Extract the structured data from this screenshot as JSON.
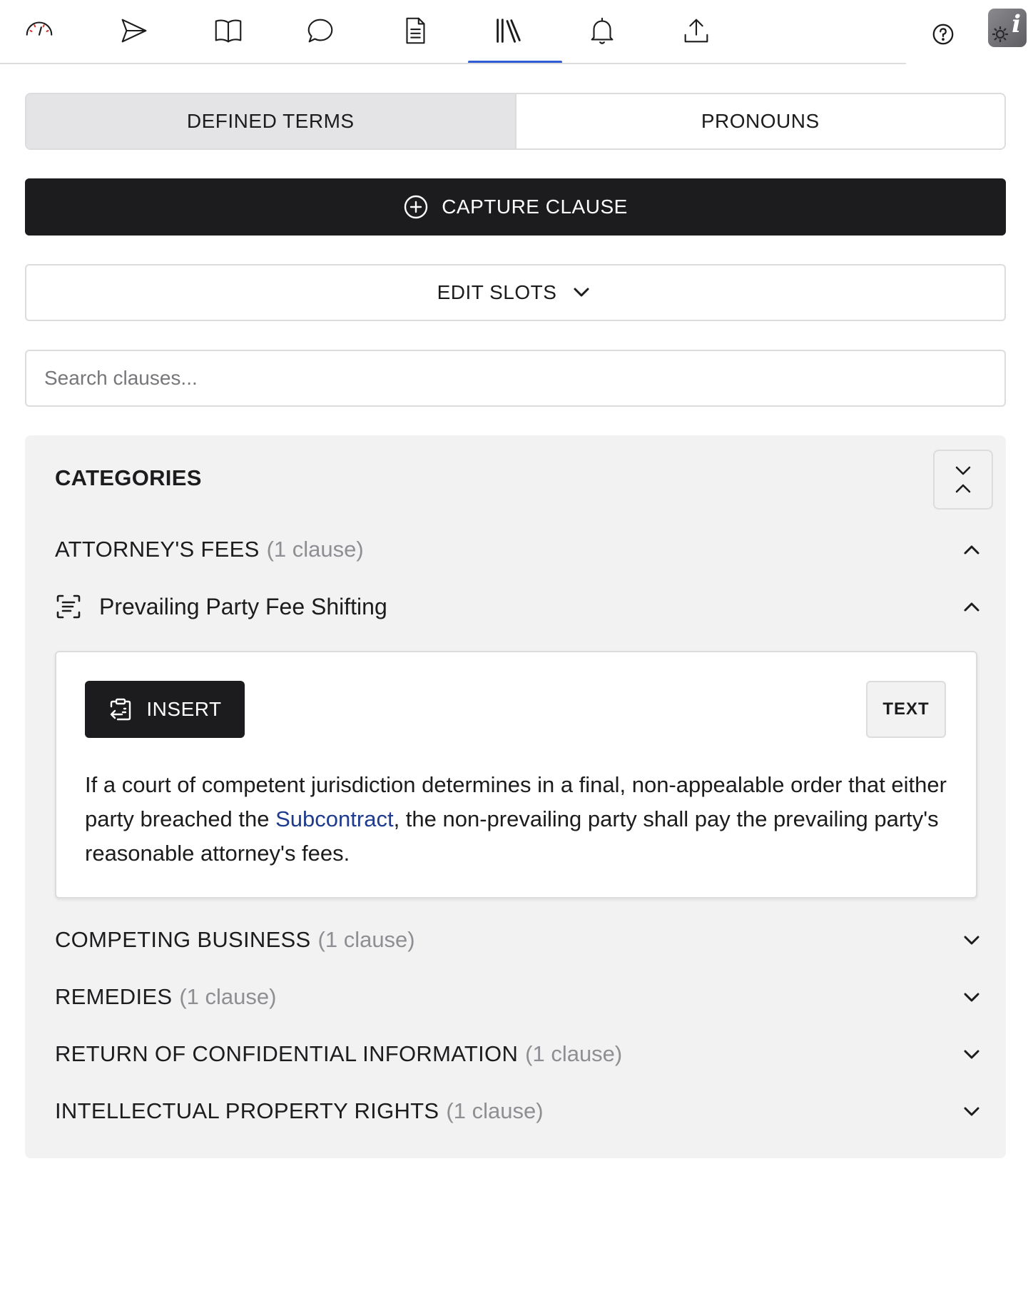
{
  "toolbar": {
    "tools": [
      {
        "name": "dashboard-icon"
      },
      {
        "name": "send-icon"
      },
      {
        "name": "book-icon"
      },
      {
        "name": "comment-icon"
      },
      {
        "name": "document-icon"
      },
      {
        "name": "library-icon",
        "active": true
      },
      {
        "name": "bell-icon"
      },
      {
        "name": "upload-icon"
      }
    ],
    "help_icon": "question-circle-icon",
    "settings_icon": "info-gear-icon",
    "settings_glyph": "i",
    "accent_color": "#2f5bd3"
  },
  "tabs": {
    "defined_terms": "DEFINED TERMS",
    "pronouns": "PRONOUNS",
    "active": "defined_terms"
  },
  "capture_button": {
    "label": "CAPTURE CLAUSE",
    "icon": "plus-circle-icon"
  },
  "edit_slots": {
    "label": "EDIT SLOTS",
    "icon": "chevron-down-icon"
  },
  "search": {
    "placeholder": "Search clauses...",
    "value": ""
  },
  "categories_panel": {
    "title": "CATEGORIES",
    "collapse_icon": "collapse-all-icon",
    "categories": [
      {
        "name": "ATTORNEY'S FEES",
        "count": "(1 clause)",
        "expanded": true,
        "clauses": [
          {
            "title": "Prevailing Party Fee Shifting",
            "icon": "scan-text-icon",
            "expanded": true,
            "insert_label": "INSERT",
            "text_label": "TEXT",
            "text_before": "If a court of competent jurisdiction determines in a final, non-appealable order that either party breached the ",
            "defined_term": "Subcontract",
            "text_after": ", the non-prevailing party shall pay the prevailing party's reasonable attorney's fees."
          }
        ]
      },
      {
        "name": "COMPETING BUSINESS",
        "count": "(1 clause)",
        "expanded": false
      },
      {
        "name": "REMEDIES",
        "count": "(1 clause)",
        "expanded": false
      },
      {
        "name": "RETURN OF CONFIDENTIAL INFORMATION",
        "count": "(1 clause)",
        "expanded": false
      },
      {
        "name": "INTELLECTUAL PROPERTY RIGHTS",
        "count": "(1 clause)",
        "expanded": false
      }
    ]
  }
}
